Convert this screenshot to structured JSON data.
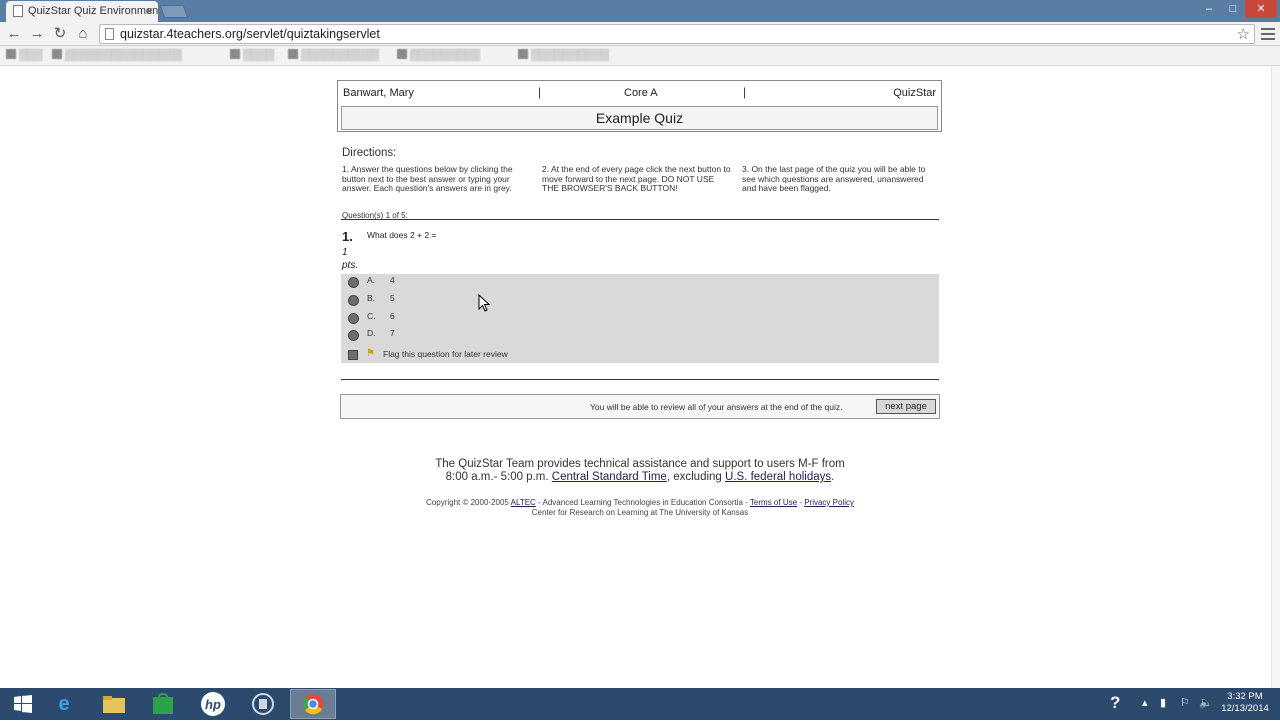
{
  "browser": {
    "tab_title": "QuizStar Quiz Environmen",
    "tab_close": "×",
    "url": "quizstar.4teachers.org/servlet/quiztakingservlet",
    "window_min": "–",
    "window_restore": "□",
    "window_close": "✕"
  },
  "header": {
    "student": "Banwart, Mary",
    "sep": "|",
    "course": "Core A",
    "brand": "QuizStar",
    "quiz_title": "Example Quiz"
  },
  "directions": {
    "heading": "Directions:",
    "step1": "1. Answer the questions below by clicking the button next to the best answer or typing your answer. Each question's answers are in grey.",
    "step2": "2. At the end of every page click the next button to move forward to the next page. DO NOT USE THE BROWSER'S BACK BUTTON!",
    "step3": "3. On the last page of the quiz you will be able to see which questions are answered, unanswered and have been flagged."
  },
  "question": {
    "count_label": "Question(s)  1 of 5:",
    "number": "1.",
    "text": "What does 2 + 2 =",
    "points_value": "1",
    "points_unit": "pts.",
    "answers": [
      {
        "letter": "A.",
        "value": "4"
      },
      {
        "letter": "B.",
        "value": "5"
      },
      {
        "letter": "C.",
        "value": "6"
      },
      {
        "letter": "D.",
        "value": "7"
      }
    ],
    "flag_label": "Flag this question for later review"
  },
  "footer_nav": {
    "review_note": "You will be able to review all of your answers at the end of the quiz.",
    "next_button": "next page"
  },
  "support": {
    "line1": "The QuizStar Team provides technical assistance and support to users M-F from",
    "line2_start": "8:00 a.m.- 5:00 p.m.",
    "tz_link": "Central Standard Time",
    "line2_mid": ", excluding",
    "holiday_link": "U.S. federal holidays",
    "line2_end": "."
  },
  "copyright": {
    "prefix": "Copyright © 2000-2005",
    "altec_link": "ALTEC",
    "mid": "- Advanced Learning Technologies in Education Consortia -",
    "terms_link": "Terms of Use",
    "dash": "-",
    "privacy_link": "Privacy Policy",
    "line2": "Center for Research on Learning at The University of Kansas"
  },
  "taskbar": {
    "help": "?",
    "time": "3:32 PM",
    "date": "12/13/2014"
  },
  "colors": {
    "tabstrip": "#5a7da3",
    "taskbar": "#2c4a6e",
    "answer_bg": "#d9d9d9"
  }
}
